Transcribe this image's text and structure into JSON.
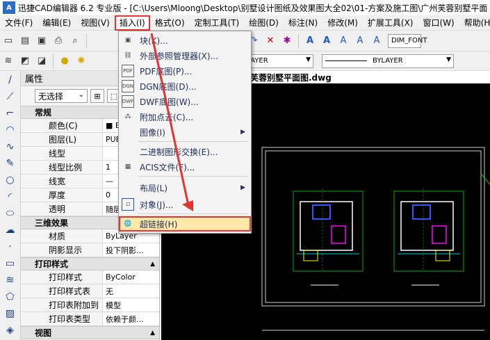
{
  "title": "迅捷CAD编辑器 6.2 专业版 - [C:\\Users\\Mloong\\Desktop\\别墅设计图纸及效果图大全02\\01-方案及施工图\\广州芙蓉别墅平面",
  "menu": [
    "文件(F)",
    "编辑(E)",
    "视图(V)",
    "插入(I)",
    "格式(O)",
    "定制工具(T)",
    "绘图(D)",
    "标注(N)",
    "修改(M)",
    "扩展工具(X)",
    "窗口(W)",
    "帮助(H)"
  ],
  "toolbar": {
    "layer_combo": "BYLAYER",
    "linetype_combo": "BYLAYER",
    "dim_style": "DIM_FONT",
    "layer_color": "#00cc00"
  },
  "insert_menu": {
    "items": [
      {
        "label": "块(K)...",
        "icon": "block-icon",
        "submenu": false
      },
      {
        "label": "外部参照管理器(X)...",
        "icon": "xref-icon",
        "submenu": false
      },
      {
        "label": "PDF底图(P)...",
        "icon": "pdf-icon",
        "submenu": false
      },
      {
        "label": "DGN底图(D)...",
        "icon": "dgn-icon",
        "submenu": false
      },
      {
        "label": "DWF底图(W)...",
        "icon": "dwf-icon",
        "submenu": false
      },
      {
        "label": "附加点云(C)...",
        "icon": "pointcloud-icon",
        "submenu": false
      },
      {
        "label": "图像(I)",
        "icon": "",
        "submenu": true
      },
      {
        "label": "二进制图形交换(E)...",
        "icon": "",
        "submenu": false
      },
      {
        "label": "ACIS文件(F)...",
        "icon": "acis-icon",
        "submenu": false
      },
      {
        "label": "布局(L)",
        "icon": "",
        "submenu": true
      },
      {
        "label": "对象(J)...",
        "icon": "object-icon",
        "submenu": false
      },
      {
        "label": "超链接(H)",
        "icon": "globe-icon",
        "submenu": false
      }
    ]
  },
  "props_panel": {
    "title": "属性",
    "selection": "无选择",
    "sections": [
      {
        "title": "常规",
        "rows": [
          {
            "k": "颜色(C)",
            "v": "■ B"
          },
          {
            "k": "图层(L)",
            "v": "PUB"
          },
          {
            "k": "线型",
            "v": ""
          },
          {
            "k": "线型比例",
            "v": "1"
          },
          {
            "k": "线宽",
            "v": "—"
          },
          {
            "k": "厚度",
            "v": "0"
          },
          {
            "k": "透明",
            "v": "随层"
          }
        ]
      },
      {
        "title": "三维效果",
        "rows": [
          {
            "k": "材质",
            "v": "ByLayer"
          },
          {
            "k": "阴影显示",
            "v": "投下阴影..."
          }
        ]
      },
      {
        "title": "打印样式",
        "rows": [
          {
            "k": "打印样式",
            "v": "ByColor"
          },
          {
            "k": "打印样式表",
            "v": "无"
          },
          {
            "k": "打印表附加到",
            "v": "模型"
          },
          {
            "k": "打印表类型",
            "v": "依赖于颜..."
          }
        ]
      },
      {
        "title": "视图",
        "rows": []
      }
    ]
  },
  "drawing_tab": "州芙蓉别墅平面图.dwg",
  "colors": {
    "accent": "#e33333",
    "highlight": "#ffe9a8",
    "canvas": "#000000"
  }
}
